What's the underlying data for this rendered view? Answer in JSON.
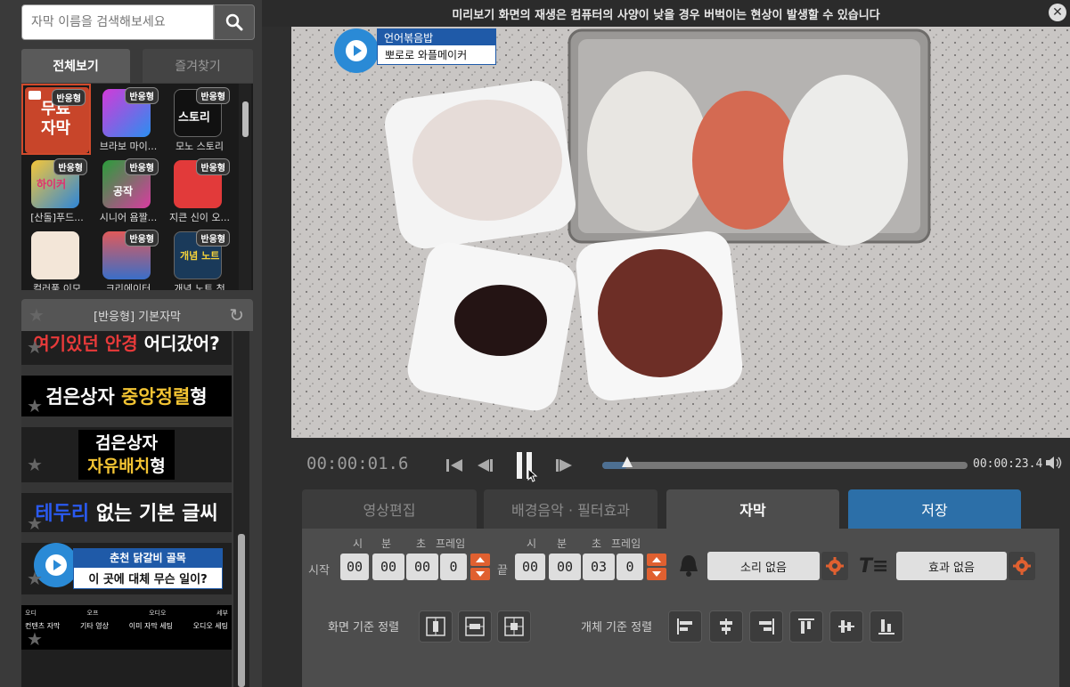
{
  "search": {
    "placeholder": "자막 이름을 검색해보세요"
  },
  "library_tabs": {
    "all": "전체보기",
    "favorites": "즐겨찾기"
  },
  "library_items": [
    {
      "label": "",
      "badge": "반응형",
      "thumb_text": "무료 자막"
    },
    {
      "label": "브라보 마이...",
      "badge": "반응형",
      "thumb_text": ""
    },
    {
      "label": "모노 스토리",
      "badge": "반응형",
      "thumb_text": "스토리"
    },
    {
      "label": "[산돌]푸드...",
      "badge": "반응형",
      "thumb_text": "하이커"
    },
    {
      "label": "시니어 욤짤...",
      "badge": "반응형",
      "thumb_text": "공작"
    },
    {
      "label": "지큰 신이 오...",
      "badge": "반응형",
      "thumb_text": ""
    },
    {
      "label": "컬러풀 이모",
      "badge": "",
      "thumb_text": ""
    },
    {
      "label": "크리에이터",
      "badge": "반응형",
      "thumb_text": ""
    },
    {
      "label": "개념 노트 첫",
      "badge": "반응형",
      "thumb_text": "개념 노트"
    }
  ],
  "preset_panel": {
    "title": "[반응형] 기본자막"
  },
  "presets": {
    "p1_a": "여기있던 ",
    "p1_b": "안경",
    "p1_c": " 어디갔어?",
    "p2_a": "검은상자 ",
    "p2_b": "중앙정렬",
    "p2_c": "형",
    "p3_a": "검은상자",
    "p3_b": "자유배치",
    "p3_c": "형",
    "p4_a": "테두리",
    "p4_b": " 없는 기본 글씨",
    "p5_title": "춘천 닭갈비 골목",
    "p5_sub": "이 곳에 대체 무슨 일이?",
    "p6_cols": [
      "오디",
      "오프",
      "오디오",
      "세부"
    ],
    "p6_labels": [
      "컨텐츠 자막",
      "기타 영상",
      "이미 자막 세팅",
      "오디오 세팅"
    ]
  },
  "preview": {
    "notice": "미리보기 화면의 재생은 컴퓨터의 사양이 낮을 경우 버벅이는 현상이 발생할 수 있습니다",
    "overlay_title": "언어볶음밥",
    "overlay_sub": "뽀로로 와플메이커"
  },
  "playback": {
    "current_time": "00:00:01.6",
    "total_time": "00:00:23.4",
    "progress": 0.068
  },
  "main_tabs": {
    "edit": "영상편집",
    "music": "배경음악 · 필터효과",
    "subtitle": "자막",
    "save": "저장"
  },
  "subtitle_settings": {
    "start_label": "시작",
    "end_label": "끝",
    "col_h": "시",
    "col_m": "분",
    "col_s": "초",
    "col_f": "프레임",
    "start": {
      "h": "00",
      "m": "00",
      "s": "00",
      "f": "0"
    },
    "end": {
      "h": "00",
      "m": "00",
      "s": "03",
      "f": "0"
    },
    "sound": "소리 없음",
    "effect": "효과 없음",
    "screen_align_label": "화면 기준 정렬",
    "object_align_label": "개체 기준 정렬"
  },
  "colors": {
    "accent_orange": "#e06030",
    "save_blue": "#2c6fa8",
    "selected_border": "#d04a2c"
  }
}
